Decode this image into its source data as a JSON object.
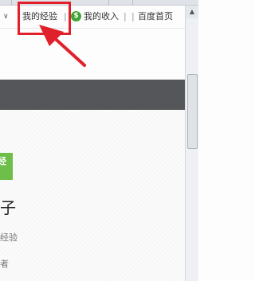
{
  "topbar": {
    "chevron_icon": "chevron-down-icon",
    "my_experience": "我的经验",
    "separator1": "|",
    "coin_icon": "coin-icon",
    "coin_glyph": "$",
    "my_income": "我的收入",
    "separator2": "|",
    "separator3": "|",
    "baidu_home": "百度首页"
  },
  "profile": {
    "badge_glyph": "经",
    "name_fragment": "子",
    "subtitle_fragment": "经验",
    "subtitle2_fragment": "者"
  },
  "annotation": {
    "highlight_color": "#e0212b",
    "arrow_icon": "pointer-arrow"
  },
  "colors": {
    "dark_bar": "#555659",
    "badge": "#6dbf4a",
    "coin": "#3fa535"
  }
}
